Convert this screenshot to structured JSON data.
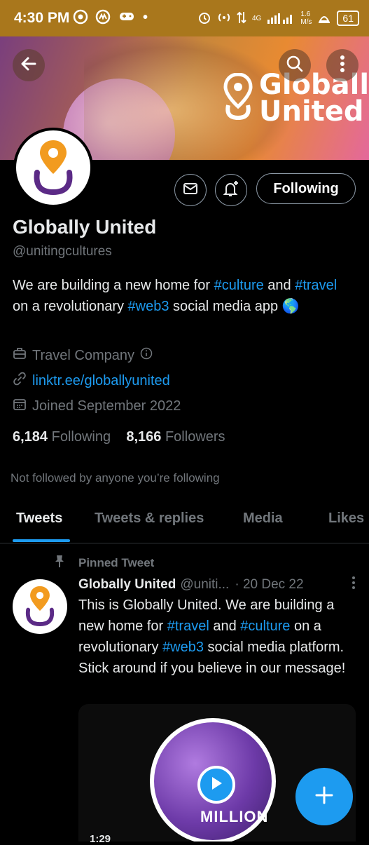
{
  "status_bar": {
    "time": "4:30 PM",
    "network": "4G",
    "speed": "1.6\nM/s",
    "battery": "61"
  },
  "profile": {
    "name": "Globally United",
    "handle": "@unitingcultures",
    "banner_logo_text_line1": "Globally",
    "banner_logo_text_line2": "United",
    "bio_parts": [
      "We are building a new home for ",
      "#culture",
      " and ",
      "#travel",
      " on a revolutionary ",
      "#web3",
      " social media app 🌎"
    ],
    "category": "Travel Company",
    "link": "linktr.ee/globallyunited",
    "joined": "Joined September 2022",
    "following_count": "6,184",
    "following_label": "Following",
    "followers_count": "8,166",
    "followers_label": "Followers",
    "not_followed_text": "Not followed by anyone you’re following"
  },
  "actions": {
    "following_button": "Following"
  },
  "tabs": [
    {
      "label": "Tweets",
      "active": true
    },
    {
      "label": "Tweets & replies",
      "active": false
    },
    {
      "label": "Media",
      "active": false
    },
    {
      "label": "Likes",
      "active": false
    }
  ],
  "pinned_tweet": {
    "pinned_label": "Pinned Tweet",
    "author_name": "Globally United",
    "author_handle": "@uniti...",
    "date": "· 20 Dec 22",
    "text_parts": [
      "This is Globally United. We are building a new home for ",
      "#travel",
      " and ",
      "#culture",
      " on a revolutionary ",
      "#web3",
      " social media platform. Stick around if you believe in our message!"
    ],
    "media_caption": "MILLION",
    "media_duration": "1:29"
  },
  "colors": {
    "accent": "#1d9bf0",
    "status_bar": "#a9771c",
    "background": "#000000",
    "secondary_text": "#71767b",
    "brand_orange": "#f29b1f",
    "brand_purple": "#5b2a86"
  },
  "icons": {
    "back": "arrow-left-icon",
    "search": "search-icon",
    "more": "more-vertical-icon",
    "message": "envelope-icon",
    "notify": "bell-plus-icon",
    "category": "briefcase-icon",
    "info": "info-icon",
    "link": "link-icon",
    "calendar": "calendar-icon",
    "pin": "pin-icon",
    "play": "play-icon",
    "compose": "plus-icon"
  }
}
